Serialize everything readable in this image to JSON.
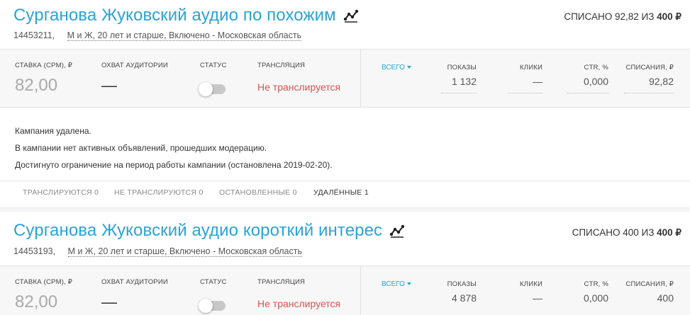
{
  "campaigns": [
    {
      "title": "Сурганова Жуковский аудио по похожим",
      "id": "14453211,",
      "targeting": "М и Ж, 20 лет и старше, Включено - Московская область",
      "spent_label": "СПИСАНО 92,82 ИЗ",
      "budget": "400 ₽",
      "bid_label": "СТАВКА (CPM), ₽",
      "bid_value": "82,00",
      "reach_label": "ОХВАТ АУДИТОРИИ",
      "reach_value": "—",
      "status_label": "СТАТУС",
      "status_on": false,
      "broadcast_label": "ТРАНСЛЯЦИЯ",
      "broadcast_value": "Не транслируется",
      "period": "ВСЕГО",
      "metrics": {
        "shows_label": "ПОКАЗЫ",
        "shows": "1 132",
        "clicks_label": "КЛИКИ",
        "clicks": "—",
        "ctr_label": "CTR, %",
        "ctr": "0,000",
        "spend_label": "СПИСАНИЯ, ₽",
        "spend": "92,82"
      },
      "messages": [
        "Кампания удалена.",
        "В кампании нет активных объявлений, прошедших модерацию.",
        "Достигнуто ограничение на период работы кампании (остановлена 2019-02-20)."
      ],
      "tabs": [
        {
          "label": "ТРАНСЛИРУЮТСЯ 0",
          "active": false
        },
        {
          "label": "НЕ ТРАНСЛИРУЮТСЯ 0",
          "active": false
        },
        {
          "label": "ОСТАНОВЛЕННЫЕ 0",
          "active": false
        },
        {
          "label": "УДАЛЁННЫЕ 1",
          "active": true
        }
      ]
    },
    {
      "title": "Сурганова Жуковский аудио короткий интерес",
      "id": "14453193,",
      "targeting": "М и Ж, 20 лет и старше, Включено - Московская область",
      "spent_label": "СПИСАНО 400 ИЗ",
      "budget": "400 ₽",
      "bid_label": "СТАВКА (CPM), ₽",
      "bid_value": "82,00",
      "reach_label": "ОХВАТ АУДИТОРИИ",
      "reach_value": "—",
      "status_label": "СТАТУС",
      "status_on": false,
      "broadcast_label": "ТРАНСЛЯЦИЯ",
      "broadcast_value": "Не транслируется",
      "period": "ВСЕГО",
      "metrics": {
        "shows_label": "ПОКАЗЫ",
        "shows": "4 878",
        "clicks_label": "КЛИКИ",
        "clicks": "—",
        "ctr_label": "CTR, %",
        "ctr": "0,000",
        "spend_label": "СПИСАНИЯ, ₽",
        "spend": "400"
      }
    }
  ],
  "colors": {
    "accent": "#2aa3d7",
    "status_off": "#d9534f",
    "panel_bg": "#f7f7f7"
  }
}
